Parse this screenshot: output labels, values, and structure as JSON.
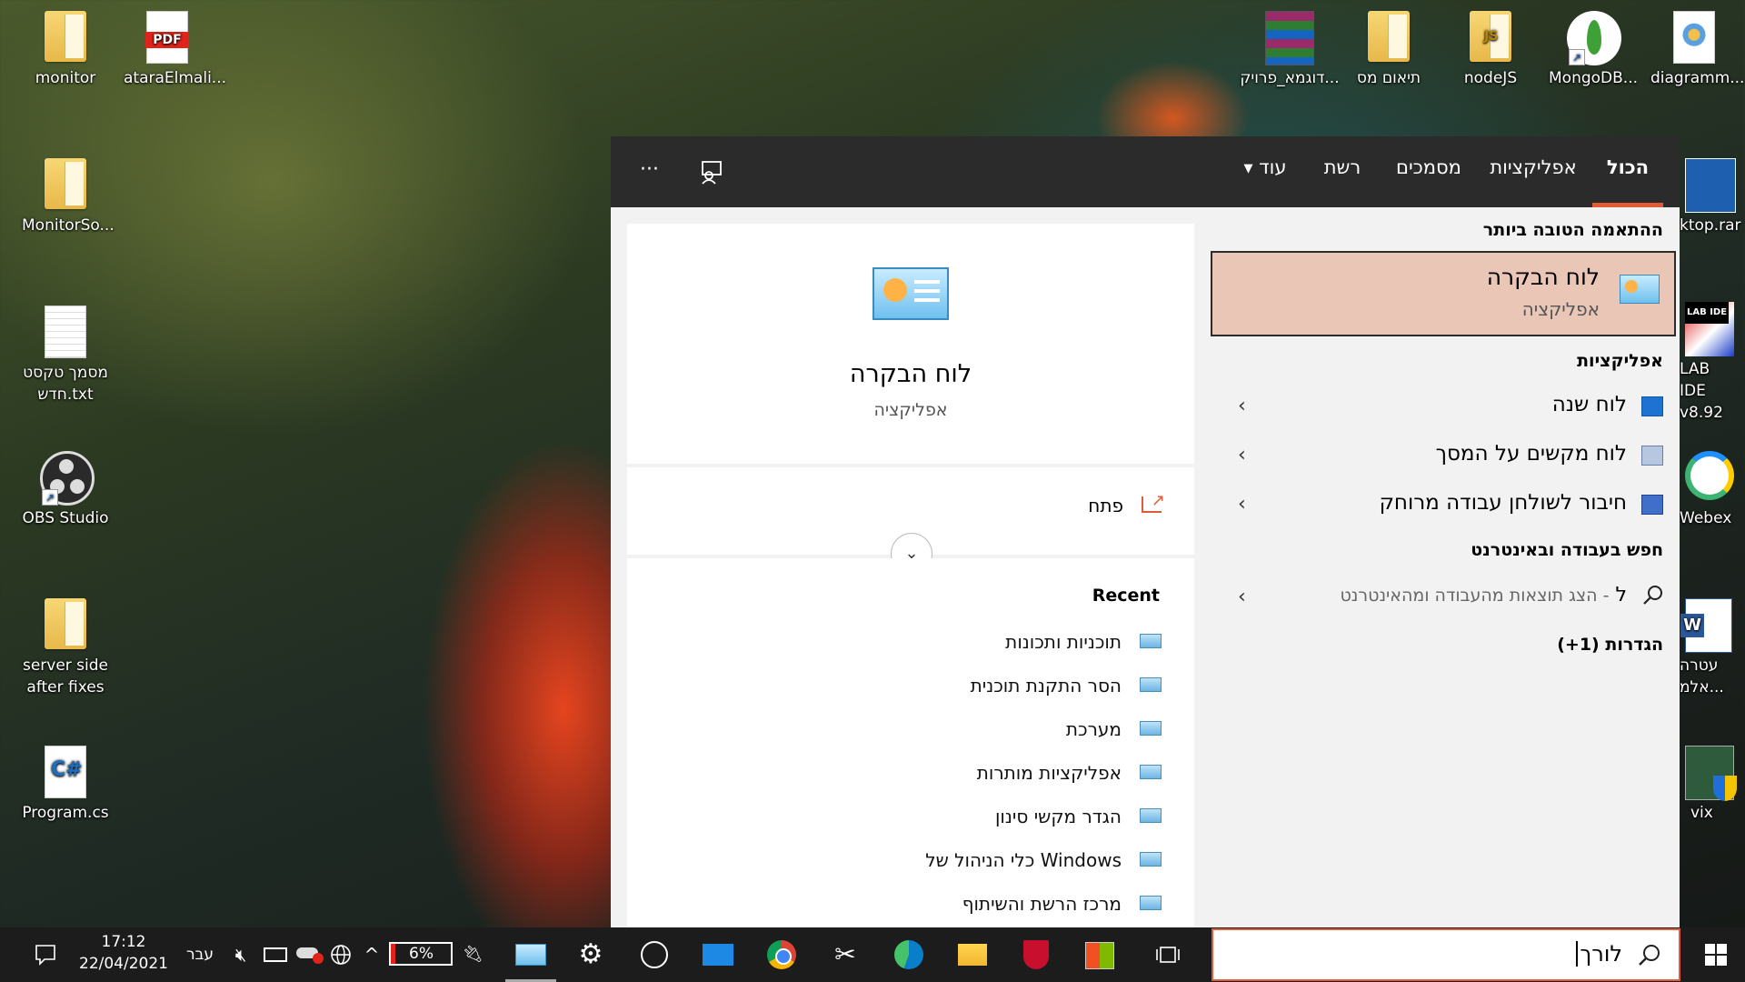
{
  "desktop": {
    "icons_left": [
      {
        "label": "monitor",
        "type": "folder"
      },
      {
        "label": "ataraElmali...",
        "type": "pdf"
      },
      {
        "label": "MonitorSo...",
        "type": "folder"
      },
      {
        "label": "מסמך טקסט חדש.txt",
        "type": "text"
      },
      {
        "label": "OBS Studio",
        "type": "obs"
      },
      {
        "label": "server side after fixes",
        "type": "folder"
      },
      {
        "label": "Program.cs",
        "type": "cs"
      }
    ],
    "icons_top": [
      {
        "label": "דוגמא_פרויק...",
        "type": "winrar"
      },
      {
        "label": "תיאום מס",
        "type": "folder-pdf"
      },
      {
        "label": "nodeJS",
        "type": "folder-js"
      },
      {
        "label": "MongoDB...",
        "type": "mongo"
      },
      {
        "label": "diagramm...",
        "type": "paint"
      }
    ],
    "icons_right": [
      {
        "label": "ktop.rar",
        "type": "archive"
      },
      {
        "label": "LAB IDE v8.92",
        "type": "labide"
      },
      {
        "label": "Webex",
        "type": "webex"
      },
      {
        "label": "עטרה אלמ...",
        "type": "word"
      },
      {
        "label": "vix",
        "type": "shield"
      }
    ],
    "labide_badge": "LAB IDE",
    "pdf_badge": "PDF",
    "js_badge": "JS",
    "cs_badge": "C#"
  },
  "search_panel": {
    "tabs": [
      {
        "label": "הכול",
        "active": true
      },
      {
        "label": "אפליקציות",
        "active": false
      },
      {
        "label": "מסמכים",
        "active": false
      },
      {
        "label": "רשת",
        "active": false
      },
      {
        "label": "עוד",
        "active": false
      }
    ],
    "more_arrow": "▼",
    "overflow_label": "···",
    "best_match": {
      "section_title": "ההתאמה הטובה ביותר",
      "title": "לוח הבקרה",
      "subtitle": "אפליקציה"
    },
    "apps": {
      "section_title": "אפליקציות",
      "items": [
        {
          "label": "לוח שנה",
          "icon": "calendar-icon"
        },
        {
          "label": "לוח מקשים על המסך",
          "icon": "keyboard-icon"
        },
        {
          "label": "חיבור לשולחן עבודה מרוחק",
          "icon": "remote-desktop-icon"
        }
      ]
    },
    "web": {
      "section_title": "חפש בעבודה ובאינטרנט",
      "query": "ל",
      "hint": "- הצג תוצאות מהעבודה ומהאינטרנט"
    },
    "settings": {
      "section_title": "הגדרות (1+)"
    },
    "preview": {
      "title": "לוח הבקרה",
      "subtitle": "אפליקציה",
      "open_label": "פתח",
      "recent_title": "Recent",
      "recent_items": [
        "תוכניות ותכונות",
        "הסר התקנת תוכנית",
        "מערכת",
        "אפליקציות מותרות",
        "הגדר מקשי סינון",
        "כלי הניהול של Windows",
        "מרכז הרשת והשיתוף"
      ]
    }
  },
  "taskbar": {
    "search_text": "לורך",
    "clock_time": "17:12",
    "clock_date": "22/04/2021",
    "language": "עבר",
    "battery": "6%",
    "colors": {
      "accent": "#e15b36",
      "taskbar": "#1c1c1c",
      "topbar": "#2b2b2b",
      "best_match_bg": "#e9c6b6"
    }
  }
}
